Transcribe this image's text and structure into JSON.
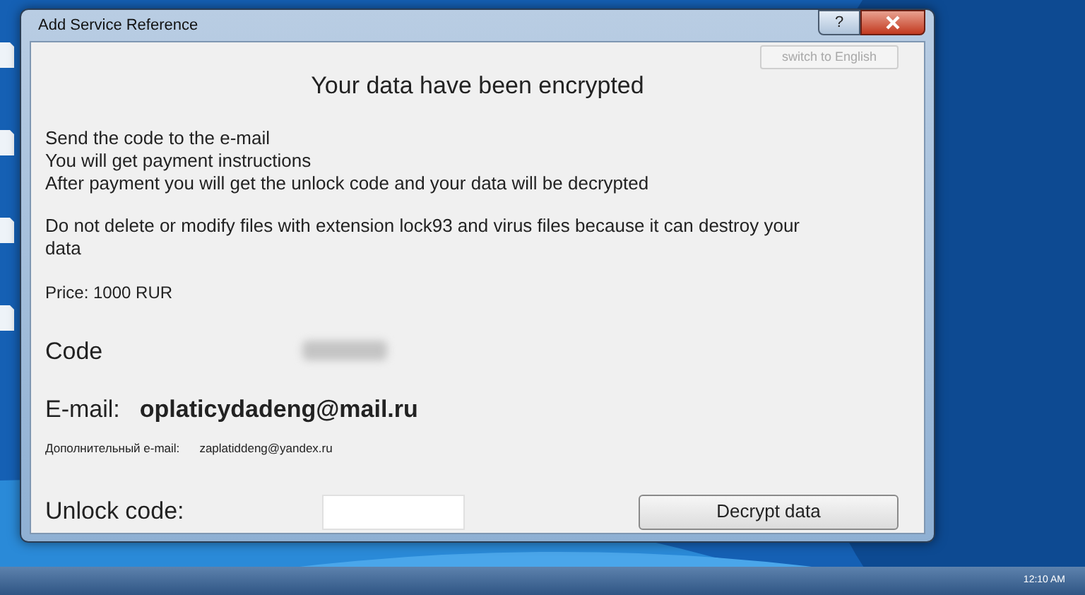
{
  "window": {
    "title": "Add Service Reference",
    "help_button": "?"
  },
  "switch_button": {
    "label": "switch to English",
    "disabled": true
  },
  "heading": "Your data have been encrypted",
  "instructions": [
    "Send the code to the e-mail",
    "You will get payment instructions",
    "After payment you will get the unlock code and your data will be decrypted"
  ],
  "warning": "Do not delete or modify files with extension lock93 and virus files because it can destroy your data",
  "price": "Price: 1000 RUR",
  "code": {
    "label": "Code"
  },
  "email": {
    "label": "E-mail:",
    "value": "oplaticydadeng@mail.ru"
  },
  "extra_email": {
    "label": "Дополнительный e-mail:",
    "value": "zaplatiddeng@yandex.ru"
  },
  "unlock": {
    "label": "Unlock code:"
  },
  "decrypt_button": "Decrypt data",
  "taskbar": {
    "clock": "12:10 AM"
  }
}
